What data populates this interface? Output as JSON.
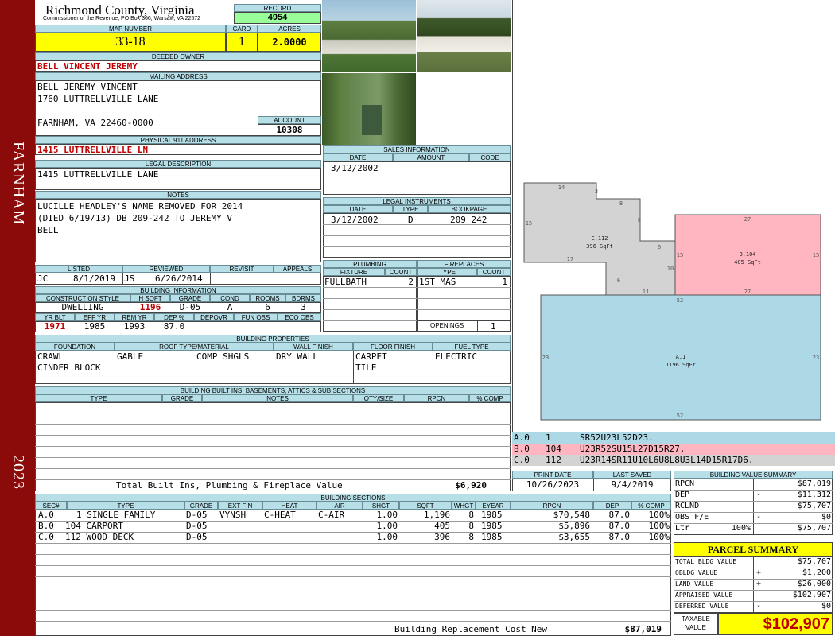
{
  "sidebar": {
    "city": "FARNHAM",
    "year": "2023"
  },
  "header": {
    "county": "Richmond County, Virginia",
    "commissioner": "Commissioner of the Revenue, PO Box 366, Warsaw, VA 22572",
    "record_label": "RECORD",
    "record": "4954",
    "map_label": "MAP NUMBER",
    "map": "33-18",
    "card_label": "CARD",
    "card": "1",
    "acres_label": "ACRES",
    "acres": "2.0000"
  },
  "owner": {
    "label": "DEEDED OWNER",
    "name": "BELL VINCENT JEREMY"
  },
  "mailing": {
    "label": "MAILING ADDRESS",
    "line1": "BELL JEREMY VINCENT",
    "line2": "1760 LUTTRELLVILLE LANE",
    "line3": "FARNHAM, VA 22460-0000",
    "account_label": "ACCOUNT",
    "account": "10308"
  },
  "physical": {
    "label": "PHYSICAL 911 ADDRESS",
    "value": "1415 LUTTRELLVILLE LN"
  },
  "legal": {
    "label": "LEGAL DESCRIPTION",
    "value": "1415 LUTTRELLVILLE LANE"
  },
  "notes": {
    "label": "NOTES",
    "line1": "LUCILLE HEADLEY'S NAME REMOVED FOR 2014",
    "line2": "(DIED 6/19/13) DB 209-242 TO JEREMY V",
    "line3": "BELL"
  },
  "review": {
    "listed_label": "LISTED",
    "reviewed_label": "REVIEWED",
    "revisit_label": "REVISIT",
    "appeals_label": "APPEALS",
    "listed_by": "JC",
    "listed_date": "8/1/2019",
    "reviewed_by": "JS",
    "reviewed_date": "6/26/2014"
  },
  "building_info": {
    "label": "BUILDING INFORMATION",
    "h1": "CONSTRUCTION STYLE",
    "h2": "H SQFT",
    "h3": "GRADE",
    "h4": "COND",
    "h5": "ROOMS",
    "h6": "BDRMS",
    "style": "DWELLING",
    "hsqft": "1196",
    "grade": "D-05",
    "cond": "A",
    "rooms": "6",
    "bdrms": "3",
    "h7": "YR BLT",
    "h8": "EFF YR",
    "h9": "REM YR",
    "h10": "DEP %",
    "h11": "DEPOVR",
    "h12": "FUN OBS",
    "h13": "ECO OBS",
    "yrblt": "1971",
    "effyr": "1985",
    "remyr": "1993",
    "dep": "87.0"
  },
  "sales": {
    "label": "SALES INFORMATION",
    "date_label": "DATE",
    "amount_label": "AMOUNT",
    "code_label": "CODE",
    "date": "3/12/2002"
  },
  "legal_instruments": {
    "label": "LEGAL INSTRUMENTS",
    "date_label": "DATE",
    "type_label": "TYPE",
    "bookpage_label": "BOOKPAGE",
    "date": "3/12/2002",
    "type": "D",
    "bookpage": "209 242"
  },
  "plumbing": {
    "label": "PLUMBING",
    "fixture_label": "FIXTURE",
    "count_label": "COUNT",
    "fixture": "FULLBATH",
    "count": "2"
  },
  "fireplaces": {
    "label": "FIREPLACES",
    "type_label": "TYPE",
    "count_label": "COUNT",
    "type": "1ST MAS",
    "count": "1",
    "openings_label": "OPENINGS",
    "openings": "1"
  },
  "properties": {
    "label": "BUILDING PROPERTIES",
    "foundation_label": "FOUNDATION",
    "roof_label": "ROOF TYPE/MATERIAL",
    "wall_label": "WALL FINISH",
    "floor_label": "FLOOR FINISH",
    "fuel_label": "FUEL TYPE",
    "foundation1": "CRAWL",
    "foundation2": "CINDER BLOCK",
    "roof_type": "GABLE",
    "roof_material": "COMP SHGLS",
    "wall": "DRY WALL",
    "floor1": "CARPET",
    "floor2": "TILE",
    "fuel": "ELECTRIC"
  },
  "builtins": {
    "label": "BUILDING BUILT INS, BASEMENTS, ATTICS & SUB SECTIONS",
    "type_label": "TYPE",
    "grade_label": "GRADE",
    "notes_label": "NOTES",
    "qty_label": "QTY/SIZE",
    "rpcn_label": "RPCN",
    "comp_label": "% COMP",
    "total_label": "Total Built Ins, Plumbing & Fireplace Value",
    "total": "$6,920"
  },
  "sketch": {
    "areas": [
      {
        "name": "C.112",
        "sqft": "396 SqFt"
      },
      {
        "name": "B.104",
        "sqft": "405 SqFt"
      },
      {
        "name": "A.1",
        "sqft": "1196 SqFt"
      }
    ],
    "dims": [
      "14",
      "3",
      "8",
      "8",
      "6",
      "15",
      "17",
      "10",
      "6",
      "11",
      "27",
      "15",
      "15",
      "27",
      "52",
      "23",
      "23",
      "52"
    ],
    "vectors": [
      {
        "code": "A.0",
        "num": "1",
        "vector": "SR52U23L52D23.",
        "color": "#add8e6"
      },
      {
        "code": "B.0",
        "num": "104",
        "vector": "U23R52SU15L27D15R27.",
        "color": "#ffb6c1"
      },
      {
        "code": "C.0",
        "num": "112",
        "vector": "U23R14SR11U10L6U8L8U3L14D15R17D6.",
        "color": "#d3d3d3"
      }
    ]
  },
  "dates": {
    "print_label": "PRINT DATE",
    "saved_label": "LAST SAVED",
    "print": "10/26/2023",
    "saved": "9/4/2019"
  },
  "value_summary": {
    "label": "BUILDING VALUE SUMMARY",
    "rows": [
      {
        "label": "RPCN",
        "sym": "",
        "value": "$87,019"
      },
      {
        "label": "DEP",
        "sym": "-",
        "value": "$11,312"
      },
      {
        "label": "RCLND",
        "sym": "",
        "value": "$75,707"
      },
      {
        "label": "OBS F/E",
        "sym": "-",
        "value": "$0"
      },
      {
        "label": "Ltr",
        "sym": "100%",
        "value": "$75,707"
      }
    ]
  },
  "parcel": {
    "label": "PARCEL SUMMARY",
    "rows": [
      {
        "label": "TOTAL BLDG VALUE",
        "sym": "",
        "value": "$75,707"
      },
      {
        "label": "OBLDG VALUE",
        "sym": "+",
        "value": "$1,200"
      },
      {
        "label": "LAND VALUE",
        "sym": "+",
        "value": "$26,000"
      },
      {
        "label": "APPRAISED VALUE",
        "sym": "",
        "value": "$102,907"
      },
      {
        "label": "DEFERRED VALUE",
        "sym": "-",
        "value": "$0"
      }
    ],
    "taxable_label1": "TAXABLE",
    "taxable_label2": "VALUE",
    "taxable": "$102,907"
  },
  "sections": {
    "label": "BUILDING SECTIONS",
    "headers": [
      "SEC#",
      "TYPE",
      "GRADE",
      "EXT FIN",
      "HEAT",
      "AIR",
      "SHGT",
      "SQFT",
      "WHGT",
      "EYEAR",
      "RPCN",
      "DEP",
      "% COMP"
    ],
    "rows": [
      [
        "A.0",
        "1 SINGLE FAMILY",
        "D-05",
        "VYNSH",
        "C-HEAT",
        "C-AIR",
        "1.00",
        "1,196",
        "8",
        "1985",
        "$70,548",
        "87.0",
        "100%"
      ],
      [
        "B.0",
        "104 CARPORT",
        "D-05",
        "",
        "",
        "",
        "1.00",
        "405",
        "8",
        "1985",
        "$5,896",
        "87.0",
        "100%"
      ],
      [
        "C.0",
        "112 WOOD DECK",
        "D-05",
        "",
        "",
        "",
        "1.00",
        "396",
        "8",
        "1985",
        "$3,655",
        "87.0",
        "100%"
      ]
    ],
    "replacement_label": "Building Replacement Cost New",
    "replacement": "$87,019"
  }
}
